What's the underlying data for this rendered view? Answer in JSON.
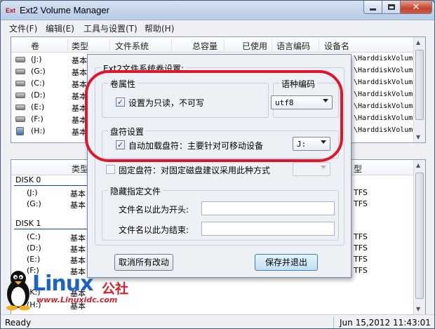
{
  "window": {
    "icon_text": "Ext",
    "title": "Ext2 Volume Manager",
    "close_glyph": "✕"
  },
  "menu": [
    "文件(F)",
    "编辑(E)",
    "工具与设置(T)",
    "帮助(H)"
  ],
  "volume_list": {
    "columns": [
      "卷",
      "类型",
      "文件系统",
      "总容量",
      "已使用",
      "语言编码",
      "设备名"
    ],
    "rows": [
      {
        "vol": "(J:)",
        "type": "基本",
        "device": "\\HarddiskVolum",
        "icon": "drive-icon"
      },
      {
        "vol": "(G:)",
        "type": "基本",
        "device": "\\HarddiskVolum",
        "icon": "drive-icon"
      },
      {
        "vol": "(C:)",
        "type": "基本",
        "device": "\\HarddiskVolum",
        "icon": "drive-icon"
      },
      {
        "vol": "(D:)",
        "type": "基本",
        "device": "\\HarddiskVolum",
        "icon": "drive-icon"
      },
      {
        "vol": "(E:)",
        "type": "基本",
        "device": "\\HarddiskVolum",
        "icon": "drive-icon"
      },
      {
        "vol": "(F:)",
        "type": "基本",
        "device": "\\HarddiskVolum",
        "icon": "drive-icon"
      },
      {
        "vol": "(H:)",
        "type": "基本",
        "device": "\\HarddiskVolum",
        "icon": "usb-drive-icon"
      }
    ]
  },
  "disk_list": {
    "columns": [
      "类型",
      "型"
    ],
    "disks": [
      {
        "name": "DISK 0",
        "partitions": [
          {
            "vol": "(J:)",
            "type": "基本",
            "fs": "TFS"
          },
          {
            "vol": "(G:)",
            "type": "基本",
            "fs": "TFS"
          }
        ]
      },
      {
        "name": "DISK 1",
        "partitions": [
          {
            "vol": "(C:)",
            "type": "基本",
            "fs": "TFS"
          },
          {
            "vol": "(D:)",
            "type": "基本",
            "fs": "TFS"
          },
          {
            "vol": "(E:)",
            "type": "基本",
            "fs": "TFS"
          },
          {
            "vol": "(F:)",
            "type": "基本",
            "fs": "TFS"
          }
        ]
      }
    ],
    "extra_rows": [
      {
        "vol": "(K:)",
        "type": "基本"
      },
      {
        "vol": "(H:)",
        "type": "基本"
      }
    ]
  },
  "status": {
    "left": "Ready",
    "right": "Jun 15,2012 11:43:01"
  },
  "dialog": {
    "outer_group_title": "Ext2文件系统卷设置:",
    "volume_props": {
      "title": "卷属性",
      "readonly_label": "设置为只读，不可写",
      "readonly_checked": true
    },
    "encoding": {
      "title": "语种编码",
      "value": "utf8"
    },
    "drive_letter": {
      "title": "盘符设置",
      "auto_label": "自动加载盘符：主要针对可移动设备",
      "auto_checked": true,
      "auto_value": "J:",
      "fixed_label": "固定盘符：对固定磁盘建议采用此种方式",
      "fixed_checked": false
    },
    "hidden": {
      "title": "隐藏指定文件",
      "prefix_label": "文件名以此为开头:",
      "prefix_value": "",
      "suffix_label": "文件名以此为结束:",
      "suffix_value": ""
    },
    "check_glyph": "✓",
    "cancel_button": "取消所有改动",
    "save_button": "保存并退出"
  },
  "watermark": {
    "brand": "Linux",
    "brand_cn": "公社",
    "url": "www.Linuxidc.com"
  }
}
